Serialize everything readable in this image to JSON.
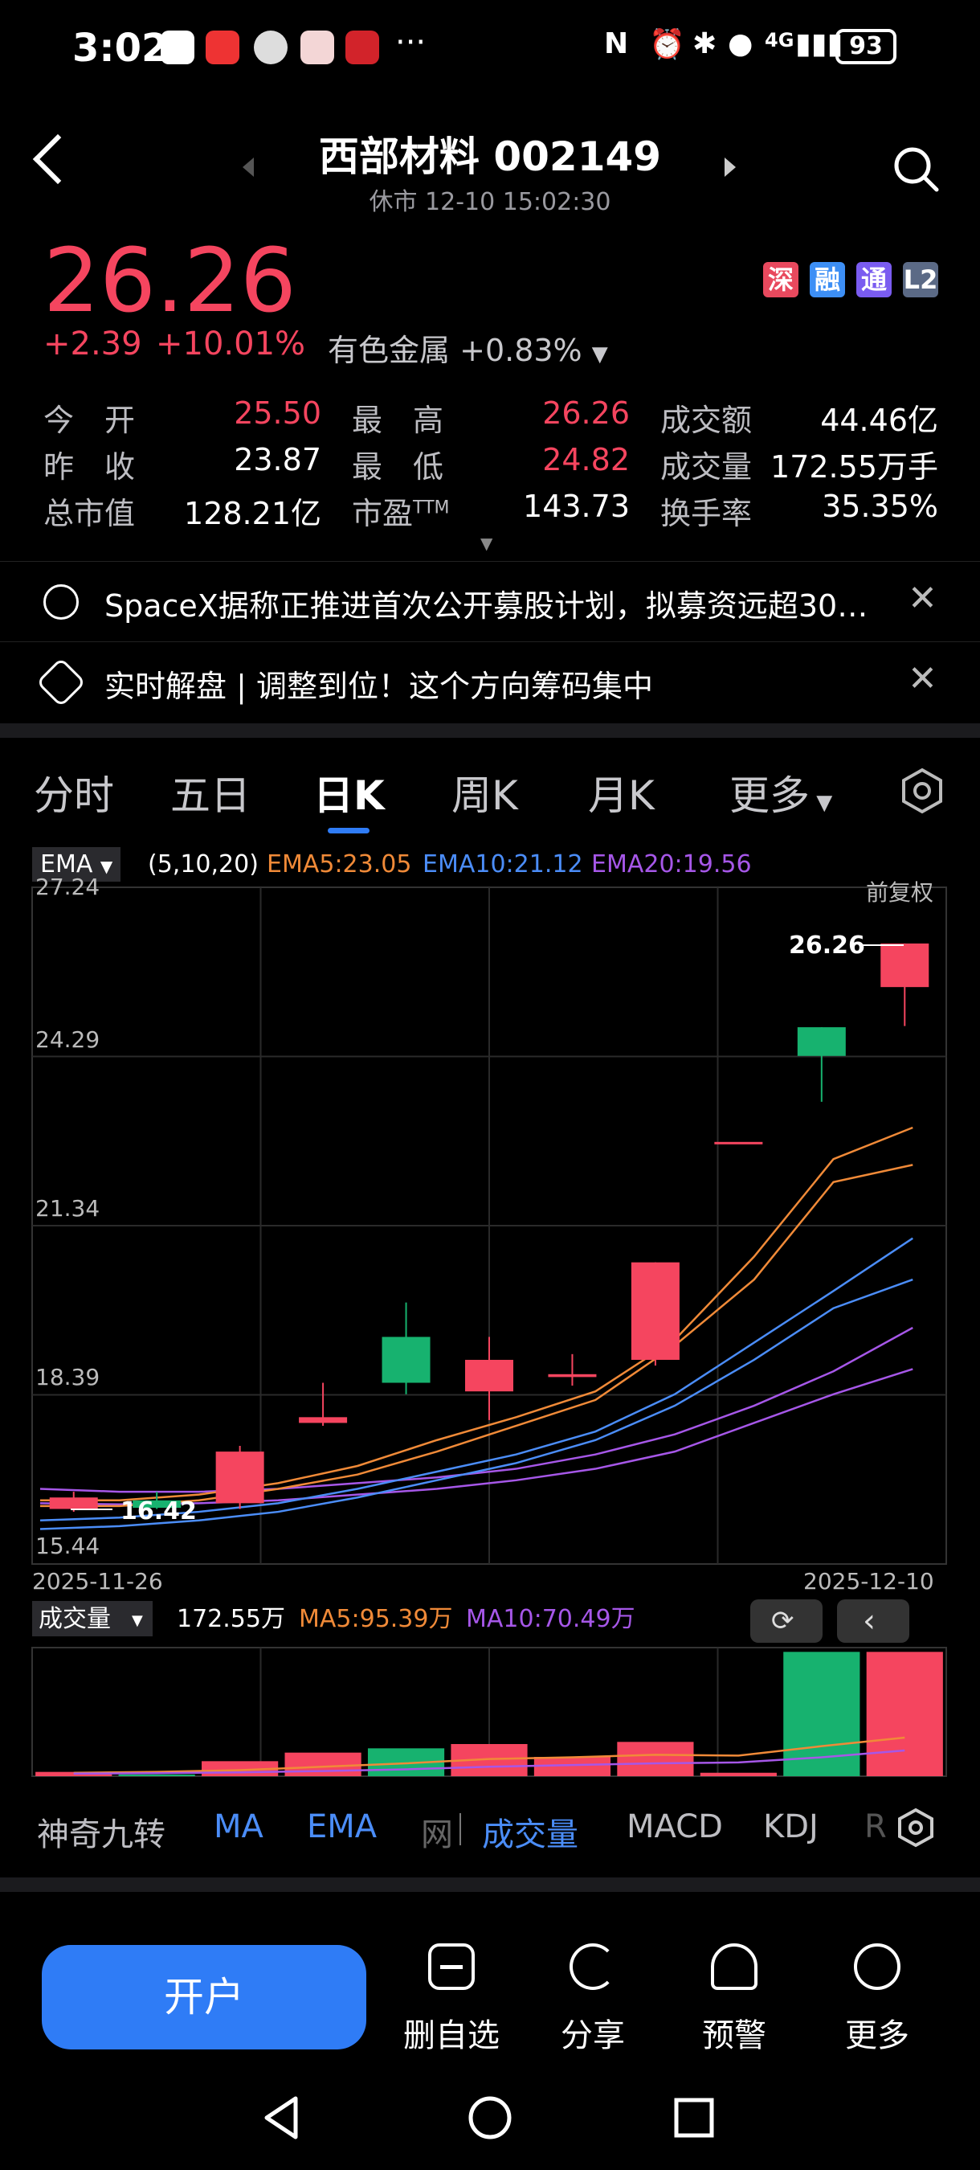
{
  "status_bar": {
    "time": "3:02",
    "dots": "···",
    "network": "4G",
    "battery": "93"
  },
  "header": {
    "title": "西部材料 002149",
    "subtitle": "休市 12-10 15:02:30"
  },
  "quote": {
    "price": "26.26",
    "change": "+2.39",
    "change_pct": "+10.01%",
    "industry": "有色金属",
    "industry_chg": "+0.83%",
    "badges": [
      "深",
      "融",
      "通",
      "L2"
    ],
    "rows": [
      {
        "l1": "今　开",
        "v1": "25.50",
        "l2": "最　高",
        "v2": "26.26",
        "l3": "成交额",
        "v3": "44.46亿"
      },
      {
        "l1": "昨　收",
        "v1": "23.87",
        "l2": "最　低",
        "v2": "24.82",
        "l3": "成交量",
        "v3": "172.55万手"
      },
      {
        "l1": "总市值",
        "v1": "128.21亿",
        "l2": "市盈",
        "v2": "143.73",
        "l3": "换手率",
        "v3": "35.35%"
      }
    ],
    "ttm": "TTM"
  },
  "news": [
    {
      "text": "SpaceX据称正推进首次公开募股计划，拟募资远超30…"
    },
    {
      "text": "实时解盘 | 调整到位！这个方向筹码集中"
    }
  ],
  "tabs": [
    "分时",
    "五日",
    "日K",
    "周K",
    "月K",
    "更多"
  ],
  "ema_legend": {
    "type": "EMA",
    "params": "(5,10,20)",
    "ema5": "EMA5:23.05",
    "ema10": "EMA10:21.12",
    "ema20": "EMA20:19.56"
  },
  "chart_labels": {
    "y_ticks": [
      "27.24",
      "24.29",
      "21.34",
      "18.39",
      "15.44"
    ],
    "adjust": "前复权",
    "high_label": "26.26",
    "low_label": "16.42",
    "date_start": "2025-11-26",
    "date_end": "2025-12-10"
  },
  "vol_legend": {
    "type": "成交量",
    "value": "172.55万",
    "ma5": "MA5:95.39万",
    "ma10": "MA10:70.49万"
  },
  "indicator_tabs": [
    "神奇九转",
    "MA",
    "EMA",
    "网",
    "成交量",
    "MACD",
    "KDJ",
    "R"
  ],
  "bottom": {
    "open_account": "开户",
    "actions": [
      "删自选",
      "分享",
      "预警",
      "更多"
    ]
  },
  "colors": {
    "up": "#f5455f",
    "down": "#17b26f",
    "ema5": "#f08a38",
    "ema10": "#4b8df8",
    "ema20": "#a657e8",
    "accent": "#2f7cf6"
  },
  "chart_data": {
    "type": "candlestick",
    "ylim": [
      15.44,
      27.24
    ],
    "candles": [
      {
        "o": 16.4,
        "h": 16.7,
        "l": 16.35,
        "c": 16.6,
        "dir": "up"
      },
      {
        "o": 16.55,
        "h": 16.7,
        "l": 16.4,
        "c": 16.42,
        "dir": "down"
      },
      {
        "o": 16.5,
        "h": 17.5,
        "l": 16.4,
        "c": 17.4,
        "dir": "up"
      },
      {
        "o": 17.9,
        "h": 18.6,
        "l": 17.85,
        "c": 18.0,
        "dir": "up"
      },
      {
        "o": 19.4,
        "h": 20.0,
        "l": 18.4,
        "c": 18.6,
        "dir": "down"
      },
      {
        "o": 18.45,
        "h": 19.4,
        "l": 17.95,
        "c": 19.0,
        "dir": "up"
      },
      {
        "o": 18.7,
        "h": 19.1,
        "l": 18.55,
        "c": 18.75,
        "dir": "up"
      },
      {
        "o": 19.0,
        "h": 20.7,
        "l": 18.9,
        "c": 20.7,
        "dir": "up"
      },
      {
        "o": 22.8,
        "h": 22.8,
        "l": 22.8,
        "c": 22.8,
        "dir": "up"
      },
      {
        "o": 24.8,
        "h": 24.8,
        "l": 23.5,
        "c": 24.3,
        "dir": "down"
      },
      {
        "o": 25.5,
        "h": 26.26,
        "l": 24.82,
        "c": 26.26,
        "dir": "up"
      }
    ],
    "ema5": [
      16.55,
      16.55,
      16.65,
      16.85,
      17.15,
      17.6,
      18.0,
      18.45,
      19.35,
      20.8,
      22.5,
      23.05
    ],
    "ema10": [
      16.2,
      16.25,
      16.35,
      16.5,
      16.75,
      17.05,
      17.35,
      17.75,
      18.4,
      19.3,
      20.2,
      21.12
    ],
    "ema20": [
      16.75,
      16.7,
      16.7,
      16.75,
      16.85,
      16.95,
      17.1,
      17.35,
      17.7,
      18.2,
      18.8,
      19.56
    ],
    "ema5b": [
      16.45,
      16.45,
      16.55,
      16.75,
      17.0,
      17.4,
      17.85,
      18.3,
      19.25,
      20.4,
      22.1,
      22.4
    ],
    "ema10b": [
      16.05,
      16.1,
      16.2,
      16.35,
      16.6,
      16.9,
      17.2,
      17.6,
      18.2,
      19.0,
      19.9,
      20.4
    ],
    "ema20b": [
      16.5,
      16.48,
      16.5,
      16.55,
      16.65,
      16.75,
      16.9,
      17.1,
      17.4,
      17.9,
      18.4,
      18.84
    ],
    "volume": [
      10,
      4,
      35,
      55,
      65,
      75,
      45,
      80,
      8,
      290,
      290
    ],
    "vol_dir": [
      "up",
      "down",
      "up",
      "up",
      "down",
      "up",
      "up",
      "up",
      "up",
      "down",
      "up"
    ],
    "vol_ma5": [
      8,
      10,
      14,
      22,
      30,
      40,
      44,
      50,
      48,
      70,
      90
    ],
    "vol_ma10": [
      6,
      7,
      9,
      12,
      16,
      22,
      26,
      30,
      32,
      44,
      60
    ]
  }
}
